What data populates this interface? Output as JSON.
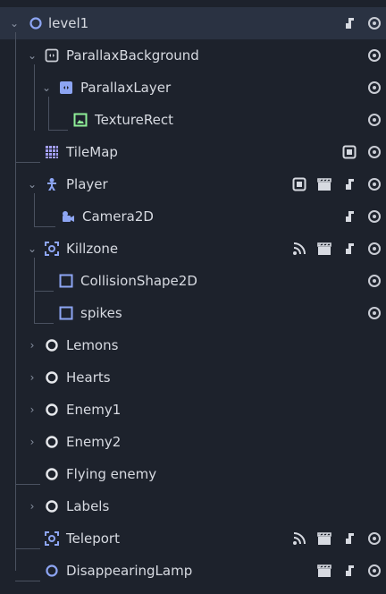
{
  "scene_tree": {
    "nodes": [
      {
        "label": "level1",
        "icon": "node-circle-icon",
        "expanded": true,
        "right": [
          "script-icon",
          "visibility-eye-icon"
        ]
      },
      {
        "label": "ParallaxBackground",
        "icon": "parallax-background-icon",
        "expanded": true,
        "right": [
          "visibility-eye-icon"
        ]
      },
      {
        "label": "ParallaxLayer",
        "icon": "parallax-layer-icon",
        "expanded": true,
        "right": [
          "visibility-eye-icon"
        ]
      },
      {
        "label": "TextureRect",
        "icon": "texture-rect-icon",
        "right": [
          "visibility-eye-icon"
        ]
      },
      {
        "label": "TileMap",
        "icon": "tilemap-icon",
        "right": [
          "group-icon",
          "visibility-eye-icon"
        ]
      },
      {
        "label": "Player",
        "icon": "character-body-icon",
        "expanded": true,
        "right": [
          "group-icon",
          "scene-clapper-icon",
          "script-icon",
          "visibility-eye-icon"
        ]
      },
      {
        "label": "Camera2D",
        "icon": "camera2d-icon",
        "right": [
          "script-icon",
          "visibility-eye-icon"
        ]
      },
      {
        "label": "Killzone",
        "icon": "area2d-icon",
        "expanded": true,
        "right": [
          "signal-icon",
          "scene-clapper-icon",
          "script-icon",
          "visibility-eye-icon"
        ]
      },
      {
        "label": "CollisionShape2D",
        "icon": "collision-shape-icon",
        "right": [
          "visibility-eye-icon"
        ]
      },
      {
        "label": "spikes",
        "icon": "collision-shape-icon",
        "right": [
          "visibility-eye-icon"
        ]
      },
      {
        "label": "Lemons",
        "icon": "node-circle-white-icon",
        "collapsed": true,
        "right": []
      },
      {
        "label": "Hearts",
        "icon": "node-circle-white-icon",
        "collapsed": true,
        "right": []
      },
      {
        "label": "Enemy1",
        "icon": "node-circle-white-icon",
        "collapsed": true,
        "right": []
      },
      {
        "label": "Enemy2",
        "icon": "node-circle-white-icon",
        "collapsed": true,
        "right": []
      },
      {
        "label": "Flying enemy",
        "icon": "node-circle-white-icon",
        "right": []
      },
      {
        "label": "Labels",
        "icon": "node-circle-white-icon",
        "collapsed": true,
        "right": []
      },
      {
        "label": "Teleport",
        "icon": "area2d-icon",
        "right": [
          "signal-icon",
          "scene-clapper-icon",
          "script-icon",
          "visibility-eye-icon"
        ]
      },
      {
        "label": "DisappearingLamp",
        "icon": "node-circle-icon",
        "right": [
          "scene-clapper-icon",
          "script-icon",
          "visibility-eye-icon"
        ]
      }
    ]
  },
  "colors": {
    "background": "#1d222c",
    "selected": "#2a3242",
    "node_blue": "#8da5f3",
    "area_blue": "#8da5f3",
    "texture_green": "#8eef97",
    "tilemap_purple": "#a29df5",
    "icon_gray": "#c9ccd4"
  }
}
